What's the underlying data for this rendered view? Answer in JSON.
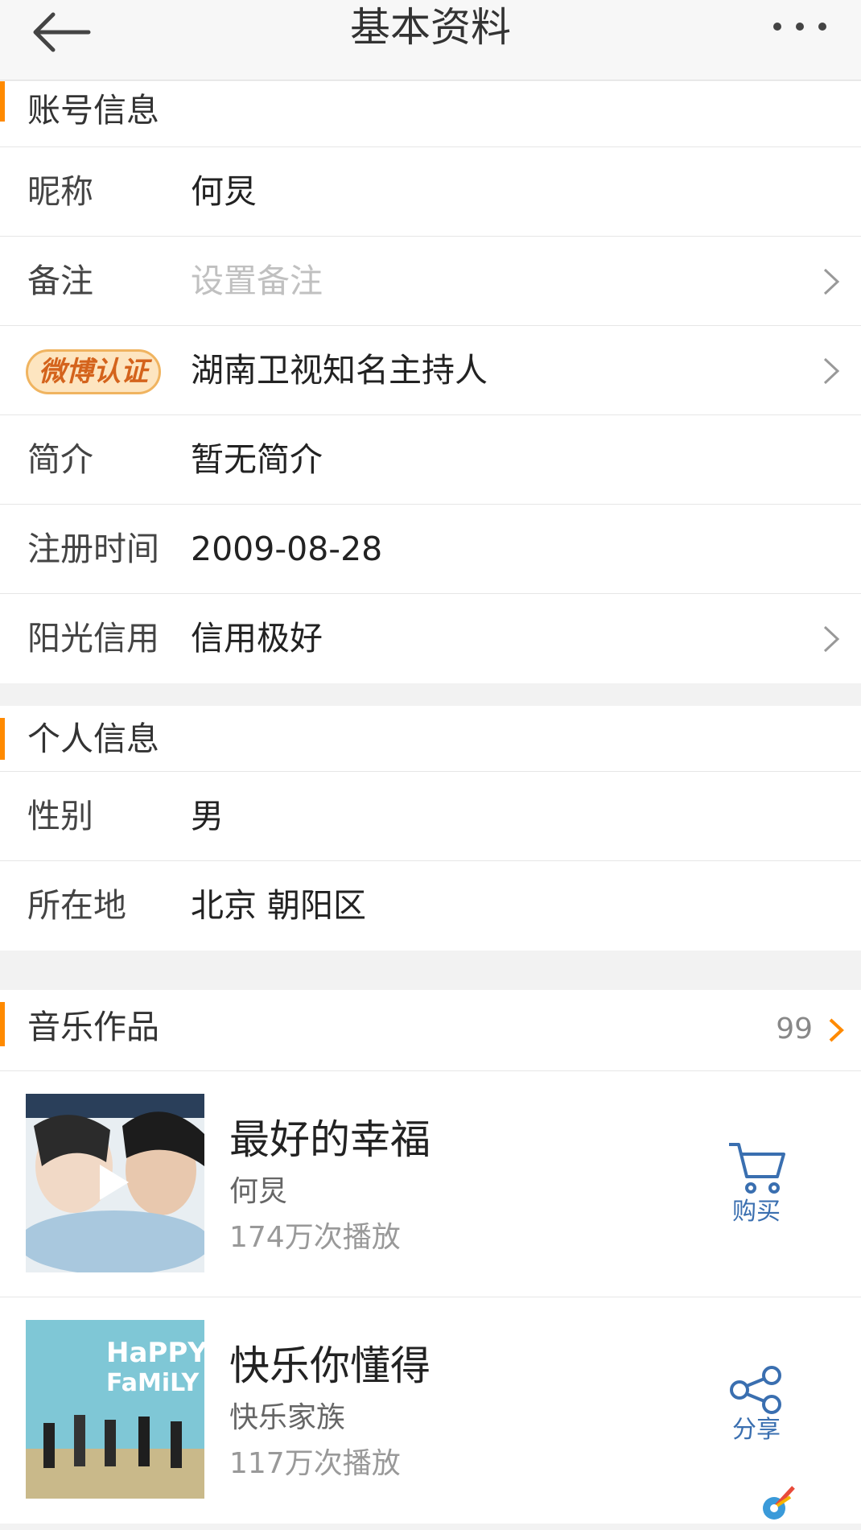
{
  "header": {
    "title": "基本资料"
  },
  "account": {
    "title": "账号信息",
    "rows": [
      {
        "label": "昵称",
        "value": "何炅"
      },
      {
        "label": "备注",
        "value": "设置备注"
      },
      {
        "badge": "微博认证",
        "value": "湖南卫视知名主持人"
      },
      {
        "label": "简介",
        "value": "暂无简介"
      },
      {
        "label": "注册时间",
        "value": "2009-08-28"
      },
      {
        "label": "阳光信用",
        "value": "信用极好"
      }
    ]
  },
  "personal": {
    "title": "个人信息",
    "rows": [
      {
        "label": "性别",
        "value": "男"
      },
      {
        "label": "所在地",
        "value": "北京 朝阳区"
      }
    ]
  },
  "music": {
    "title": "音乐作品",
    "count": "99",
    "songs": [
      {
        "title": "最好的幸福",
        "artist": "何炅",
        "plays": "174万次播放",
        "action": "购买"
      },
      {
        "title": "快乐你懂得",
        "artist": "快乐家族",
        "plays": "117万次播放",
        "action": "分享"
      }
    ],
    "cover2_text": {
      "line1": "HaPPY",
      "line2": "FaMiLY"
    }
  },
  "colors": {
    "accent": "#ff8a00",
    "link": "#3a6fb0",
    "badge_bg": "#fde5c0"
  }
}
